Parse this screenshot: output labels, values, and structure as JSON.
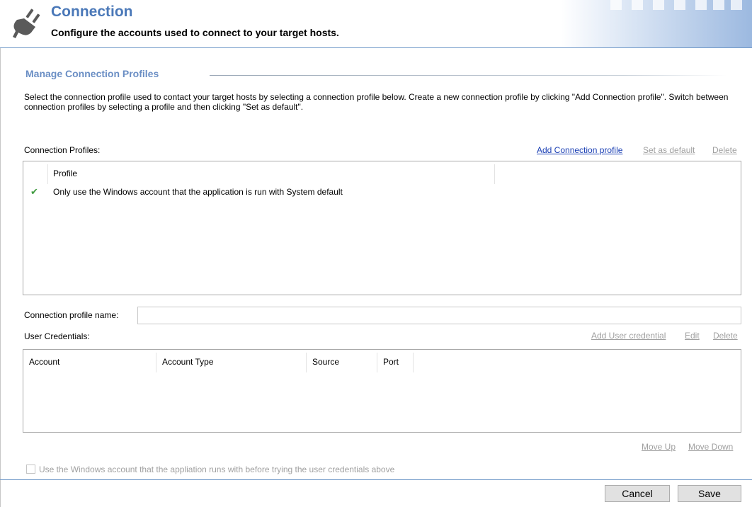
{
  "header": {
    "title": "Connection",
    "subtitle": "Configure the accounts used to connect to your target hosts."
  },
  "section": {
    "heading": "Manage Connection Profiles",
    "description": "Select the connection profile used to contact your target hosts by selecting a connection profile below. Create a new connection profile by clicking \"Add Connection profile\". Switch between connection profiles by selecting a profile and then clicking \"Set as default\"."
  },
  "profiles": {
    "label": "Connection Profiles:",
    "add_link": "Add Connection profile",
    "set_default_link": "Set as default",
    "delete_link": "Delete",
    "column_header": "Profile",
    "rows": [
      {
        "name": "Only use the Windows account that the application is run with System default",
        "is_default": true
      }
    ]
  },
  "profile_name": {
    "label": "Connection profile name:",
    "value": "",
    "placeholder": ""
  },
  "credentials": {
    "label": "User Credentials:",
    "add_link": "Add User credential",
    "edit_link": "Edit",
    "delete_link": "Delete",
    "columns": [
      "Account",
      "Account Type",
      "Source",
      "Port"
    ],
    "move_up_link": "Move Up",
    "move_down_link": "Move Down"
  },
  "fallback_checkbox": {
    "label": "Use the Windows account that the appliation runs with before trying the user credentials above",
    "checked": false
  },
  "footer": {
    "cancel_label": "Cancel",
    "save_label": "Save"
  },
  "icons": {
    "header_icon": "plug-icon",
    "default_row_icon": "checkmark-icon"
  },
  "colors": {
    "title": "#4a78b8",
    "section_heading": "#6a8ec4",
    "active_link": "#1a3fb4",
    "disabled_link": "#a0a0a0",
    "check": "#3f9a3f",
    "header_rule": "#6f98c8"
  }
}
